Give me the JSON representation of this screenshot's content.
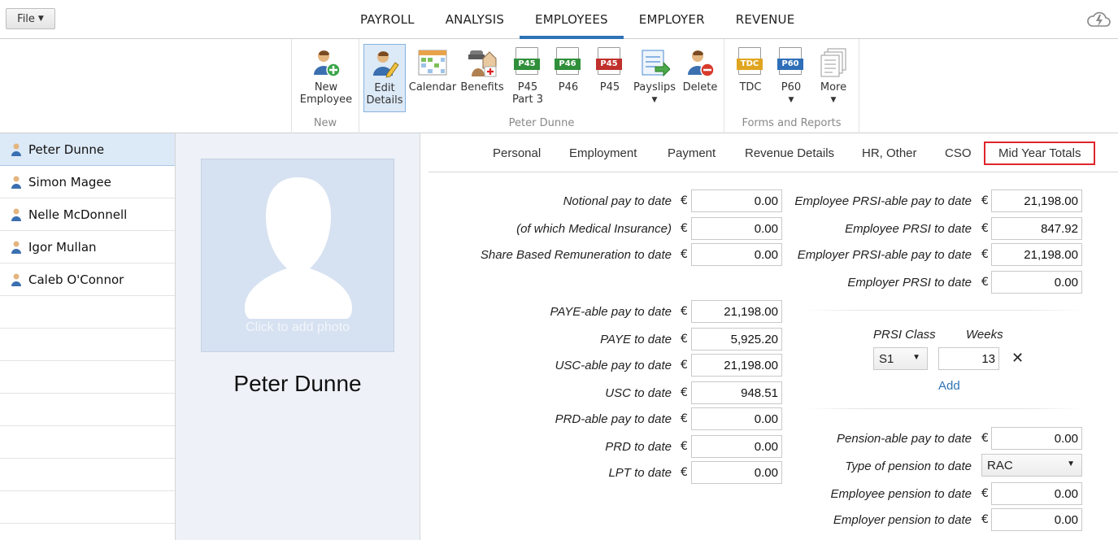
{
  "file_menu": {
    "label": "File"
  },
  "nav": {
    "items": [
      {
        "label": "PAYROLL"
      },
      {
        "label": "ANALYSIS"
      },
      {
        "label": "EMPLOYEES"
      },
      {
        "label": "EMPLOYER"
      },
      {
        "label": "REVENUE"
      }
    ],
    "active": "EMPLOYEES"
  },
  "ribbon": {
    "groups": {
      "new": "New",
      "employee": "Peter Dunne",
      "forms": "Forms and Reports"
    },
    "buttons": {
      "new_employee": "New\nEmployee",
      "edit_details": "Edit\nDetails",
      "calendar": "Calendar",
      "benefits": "Benefits",
      "p45_part3": "P45\nPart 3",
      "p46": "P46",
      "p45": "P45",
      "payslips": "Payslips",
      "delete": "Delete",
      "tdc": "TDC",
      "p60": "P60",
      "more": "More"
    },
    "icon_tags": {
      "p45_part3": "P45",
      "p46": "P46",
      "p45": "P45",
      "tdc": "TDC",
      "p60": "P60"
    },
    "dropdown_glyph": "▼"
  },
  "employees": [
    {
      "name": "Peter Dunne"
    },
    {
      "name": "Simon Magee"
    },
    {
      "name": "Nelle McDonnell"
    },
    {
      "name": "Igor Mullan"
    },
    {
      "name": "Caleb O'Connor"
    }
  ],
  "photo": {
    "hint": "Click to add photo",
    "name": "Peter Dunne"
  },
  "tabs": [
    {
      "label": "Personal"
    },
    {
      "label": "Employment"
    },
    {
      "label": "Payment"
    },
    {
      "label": "Revenue Details"
    },
    {
      "label": "HR, Other"
    },
    {
      "label": "CSO"
    },
    {
      "label": "Mid Year Totals"
    }
  ],
  "currency": "€",
  "left_fields": {
    "notional_pay": {
      "label": "Notional pay to date",
      "value": "0.00"
    },
    "medical_insurance": {
      "label": "(of which Medical Insurance)",
      "value": "0.00"
    },
    "share_based": {
      "label": "Share Based Remuneration to date",
      "value": "0.00"
    },
    "paye_able": {
      "label": "PAYE-able pay to date",
      "value": "21,198.00"
    },
    "paye": {
      "label": "PAYE to date",
      "value": "5,925.20"
    },
    "usc_able": {
      "label": "USC-able pay to date",
      "value": "21,198.00"
    },
    "usc": {
      "label": "USC to date",
      "value": "948.51"
    },
    "prd_able": {
      "label": "PRD-able pay to date",
      "value": "0.00"
    },
    "prd": {
      "label": "PRD to date",
      "value": "0.00"
    },
    "lpt": {
      "label": "LPT to date",
      "value": "0.00"
    }
  },
  "right_fields": {
    "emp_prsi_able": {
      "label": "Employee PRSI-able pay to date",
      "value": "21,198.00"
    },
    "emp_prsi": {
      "label": "Employee PRSI to date",
      "value": "847.92"
    },
    "er_prsi_able": {
      "label": "Employer PRSI-able pay to date",
      "value": "21,198.00"
    },
    "er_prsi": {
      "label": "Employer PRSI to date",
      "value": "0.00"
    },
    "pension_able": {
      "label": "Pension-able pay to date",
      "value": "0.00"
    },
    "pension_type": {
      "label": "Type of pension to date",
      "value": "RAC"
    },
    "emp_pension": {
      "label": "Employee pension to date",
      "value": "0.00"
    },
    "er_pension": {
      "label": "Employer pension to date",
      "value": "0.00"
    }
  },
  "prsi": {
    "class_label": "PRSI Class",
    "weeks_label": "Weeks",
    "class_value": "S1",
    "weeks_value": "13",
    "remove_glyph": "✕",
    "add_label": "Add"
  }
}
